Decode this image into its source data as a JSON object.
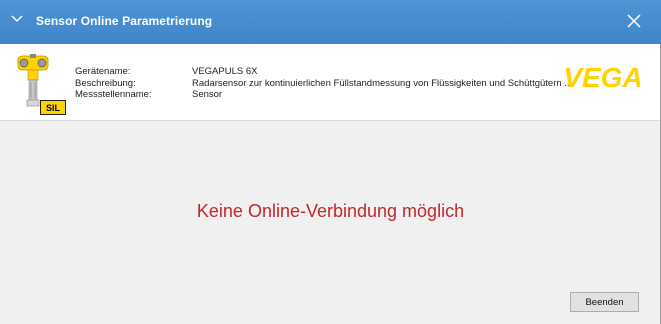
{
  "window": {
    "title": "Sensor Online Parametrierung",
    "colors": {
      "titlebar": "#4a90d0",
      "error_text": "#c0282d",
      "logo_yellow": "#ffd200"
    },
    "icons": {
      "collapse": "chevron-down-icon",
      "close": "close-icon"
    }
  },
  "header": {
    "labels": [
      "Gerätename:",
      "Beschreibung:",
      "Messstellenname:"
    ],
    "values": [
      "VEGAPULS 6X",
      "Radarsensor zur kontinuierlichen Füllstandmessung von Flüssigkeiten und Schüttgütern ...",
      "Sensor"
    ],
    "sil_badge": "SIL",
    "logo_text": "VEGA"
  },
  "main": {
    "message": "Keine Online-Verbindung möglich",
    "close_button_label": "Beenden"
  }
}
